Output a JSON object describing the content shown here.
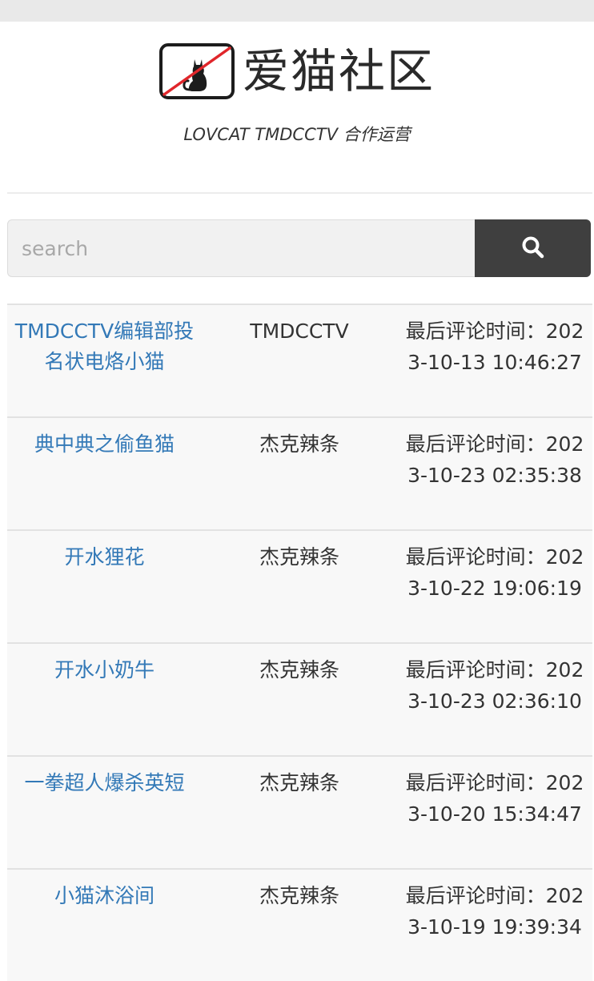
{
  "header": {
    "site_name": "爱猫社区",
    "logo_icon": "no-cat-sign-icon",
    "tagline": "LOVCAT TMDCCTV 合作运营"
  },
  "search": {
    "placeholder": "search",
    "value": "",
    "button_icon": "search-icon"
  },
  "colors": {
    "link": "#3379b7",
    "text": "#333333",
    "button_bg": "#3f3f3f",
    "row_bg": "#f8f8f8",
    "logo_slash": "#e0262b"
  },
  "posts": [
    {
      "title": "TMDCCTV编辑部投名状电烙小猫",
      "author": "TMDCCTV",
      "last_comment": "最后评论时间：2023-10-13 10:46:27"
    },
    {
      "title": "典中典之偷鱼猫",
      "author": "杰克辣条",
      "last_comment": "最后评论时间：2023-10-23 02:35:38"
    },
    {
      "title": "开水狸花",
      "author": "杰克辣条",
      "last_comment": "最后评论时间：2023-10-22 19:06:19"
    },
    {
      "title": "开水小奶牛",
      "author": "杰克辣条",
      "last_comment": "最后评论时间：2023-10-23 02:36:10"
    },
    {
      "title": "一拳超人爆杀英短",
      "author": "杰克辣条",
      "last_comment": "最后评论时间：2023-10-20 15:34:47"
    },
    {
      "title": "小猫沐浴间",
      "author": "杰克辣条",
      "last_comment": "最后评论时间：2023-10-19 19:39:34"
    }
  ]
}
